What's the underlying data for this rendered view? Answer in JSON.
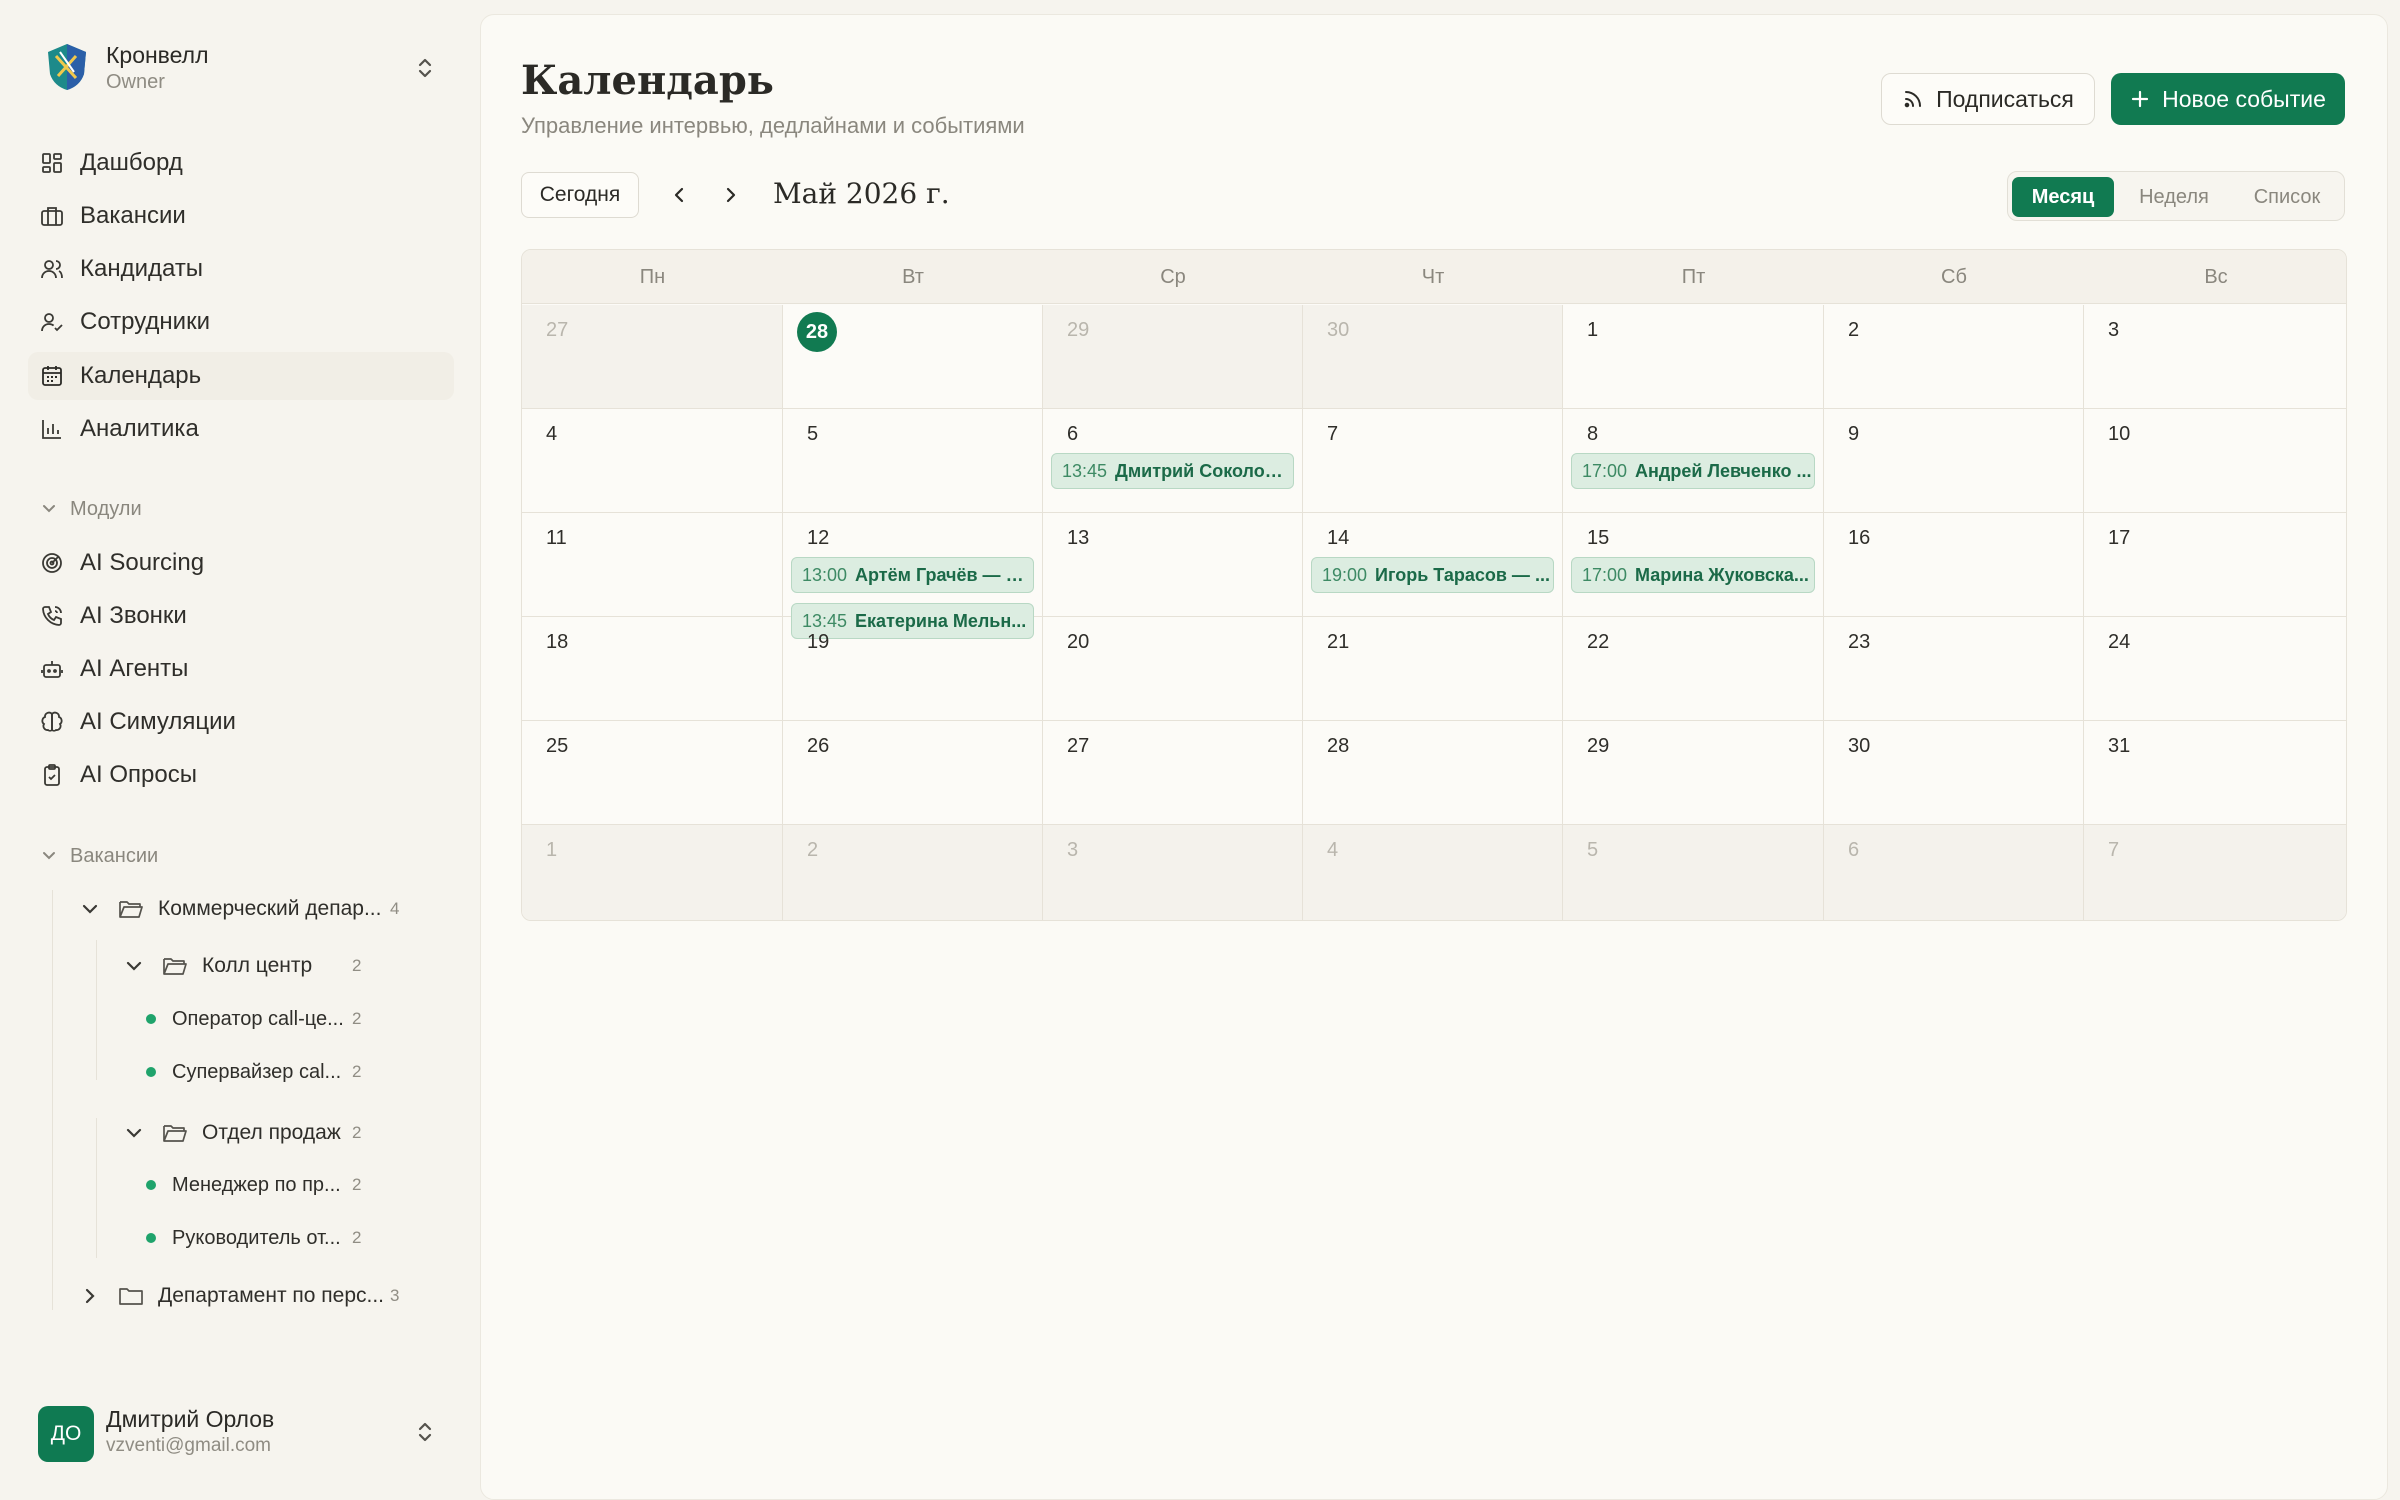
{
  "org": {
    "name": "Кронвелл",
    "role": "Owner"
  },
  "nav": [
    {
      "label": "Дашборд",
      "icon": "dashboard-icon"
    },
    {
      "label": "Вакансии",
      "icon": "briefcase-icon"
    },
    {
      "label": "Кандидаты",
      "icon": "users-icon"
    },
    {
      "label": "Сотрудники",
      "icon": "user-check-icon"
    },
    {
      "label": "Календарь",
      "icon": "calendar-icon",
      "active": true
    },
    {
      "label": "Аналитика",
      "icon": "bar-chart-icon"
    }
  ],
  "modules": {
    "title": "Модули",
    "items": [
      {
        "label": "AI Sourcing",
        "icon": "radar-icon"
      },
      {
        "label": "AI Звонки",
        "icon": "phone-icon"
      },
      {
        "label": "AI Агенты",
        "icon": "bot-icon"
      },
      {
        "label": "AI Симуляции",
        "icon": "brain-icon"
      },
      {
        "label": "AI Опросы",
        "icon": "clipboard-check-icon"
      }
    ]
  },
  "vacancies": {
    "title": "Вакансии",
    "tree": {
      "dept1": {
        "label": "Коммерческий депар...",
        "count": "4"
      },
      "group1": {
        "label": "Колл центр",
        "count": "2"
      },
      "g1_items": [
        {
          "label": "Оператор call-це...",
          "count": "2"
        },
        {
          "label": "Супервайзер cal...",
          "count": "2"
        }
      ],
      "group2": {
        "label": "Отдел продаж",
        "count": "2"
      },
      "g2_items": [
        {
          "label": "Менеджер по пр...",
          "count": "2"
        },
        {
          "label": "Руководитель от...",
          "count": "2"
        }
      ],
      "dept2": {
        "label": "Департамент по перс...",
        "count": "3"
      }
    }
  },
  "user": {
    "initials": "ДО",
    "name": "Дмитрий Орлов",
    "email": "vzventi@gmail.com"
  },
  "header": {
    "title": "Календарь",
    "subtitle": "Управление интервью, дедлайнами и событиями",
    "subscribe_label": "Подписаться",
    "new_event_label": "Новое событие"
  },
  "toolbar": {
    "today_label": "Сегодня",
    "month_label": "Май 2026 г.",
    "views": [
      "Месяц",
      "Неделя",
      "Список"
    ],
    "active_view": "Месяц"
  },
  "calendar": {
    "weekdays": [
      "Пн",
      "Вт",
      "Ср",
      "Чт",
      "Пт",
      "Сб",
      "Вс"
    ],
    "today": "28",
    "weeks": [
      [
        {
          "day": "27",
          "muted": true
        },
        {
          "day": "28",
          "today": true
        },
        {
          "day": "29",
          "muted": true
        },
        {
          "day": "30",
          "muted": true
        },
        {
          "day": "1"
        },
        {
          "day": "2"
        },
        {
          "day": "3"
        }
      ],
      [
        {
          "day": "4"
        },
        {
          "day": "5"
        },
        {
          "day": "6",
          "events": [
            {
              "time": "13:45",
              "title": "Дмитрий Соколов ..."
            }
          ]
        },
        {
          "day": "7"
        },
        {
          "day": "8",
          "events": [
            {
              "time": "17:00",
              "title": "Андрей Левченко ..."
            }
          ]
        },
        {
          "day": "9"
        },
        {
          "day": "10"
        }
      ],
      [
        {
          "day": "11"
        },
        {
          "day": "12",
          "events": [
            {
              "time": "13:00",
              "title": "Артём Грачёв — С..."
            },
            {
              "time": "13:45",
              "title": "Екатерина Мельн..."
            }
          ]
        },
        {
          "day": "13"
        },
        {
          "day": "14",
          "events": [
            {
              "time": "19:00",
              "title": "Игорь Тарасов — ..."
            }
          ]
        },
        {
          "day": "15",
          "events": [
            {
              "time": "17:00",
              "title": "Марина Жуковска..."
            }
          ]
        },
        {
          "day": "16"
        },
        {
          "day": "17"
        }
      ],
      [
        {
          "day": "18"
        },
        {
          "day": "19"
        },
        {
          "day": "20"
        },
        {
          "day": "21"
        },
        {
          "day": "22"
        },
        {
          "day": "23"
        },
        {
          "day": "24"
        }
      ],
      [
        {
          "day": "25"
        },
        {
          "day": "26"
        },
        {
          "day": "27"
        },
        {
          "day": "28"
        },
        {
          "day": "29"
        },
        {
          "day": "30"
        },
        {
          "day": "31"
        }
      ],
      [
        {
          "day": "1",
          "muted": true
        },
        {
          "day": "2",
          "muted": true
        },
        {
          "day": "3",
          "muted": true
        },
        {
          "day": "4",
          "muted": true
        },
        {
          "day": "5",
          "muted": true
        },
        {
          "day": "6",
          "muted": true
        },
        {
          "day": "7",
          "muted": true
        }
      ]
    ]
  },
  "colors": {
    "accent": "#117a51",
    "event_bg": "#dcede1",
    "event_border": "#b8d8c4"
  }
}
